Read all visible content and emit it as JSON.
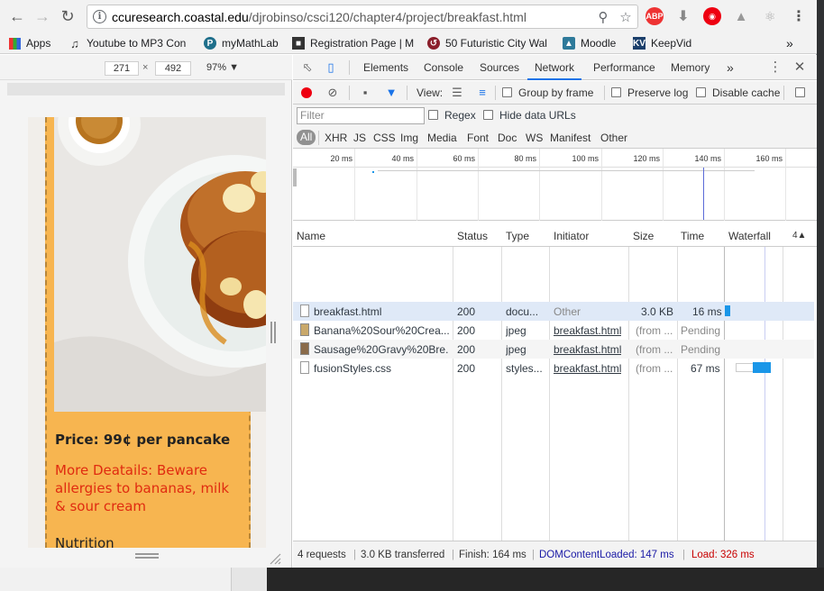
{
  "browser": {
    "url_host": "ccuresearch.coastal.edu",
    "url_path": "/djrobinso/csci120/chapter4/project/breakfast.html",
    "bookmarks": [
      {
        "label": "Apps"
      },
      {
        "label": "Youtube to MP3 Con"
      },
      {
        "label": "myMathLab"
      },
      {
        "label": "Registration Page | M"
      },
      {
        "label": "50 Futuristic City Wal"
      },
      {
        "label": "Moodle"
      },
      {
        "label": "KeepVid"
      }
    ],
    "more_bookmarks": "»"
  },
  "device": {
    "width": "271",
    "height": "492",
    "zoom": "97%"
  },
  "page": {
    "price": "Price: 99¢ per pancake",
    "details": "More Deatails: Beware allergies to bananas, milk & sour cream",
    "nutrition": "Nutrition"
  },
  "devtools": {
    "tabs": [
      "Elements",
      "Console",
      "Sources",
      "Network",
      "Performance",
      "Memory"
    ],
    "more_tabs": "»",
    "toolbar": {
      "view_label": "View:",
      "group_by_frame": "Group by frame",
      "preserve_log": "Preserve log",
      "disable_cache": "Disable cache"
    },
    "filter_placeholder": "Filter",
    "regex": "Regex",
    "hide_data_urls": "Hide data URLs",
    "types": [
      "All",
      "XHR",
      "JS",
      "CSS",
      "Img",
      "Media",
      "Font",
      "Doc",
      "WS",
      "Manifest",
      "Other"
    ],
    "timeline_labels": [
      "20 ms",
      "40 ms",
      "60 ms",
      "80 ms",
      "100 ms",
      "120 ms",
      "140 ms",
      "160 ms"
    ],
    "columns": [
      "Name",
      "Status",
      "Type",
      "Initiator",
      "Size",
      "Time",
      "Waterfall"
    ],
    "sort_indicator": "4▲",
    "requests": [
      {
        "name": "breakfast.html",
        "status": "200",
        "type": "docu...",
        "initiator": "Other",
        "size": "3.0 KB",
        "time": "16 ms"
      },
      {
        "name": "Banana%20Sour%20Crea...",
        "status": "200",
        "type": "jpeg",
        "initiator": "breakfast.html",
        "size": "(from ...",
        "time": "Pending"
      },
      {
        "name": "Sausage%20Gravy%20Bre...",
        "status": "200",
        "type": "jpeg",
        "initiator": "breakfast.html",
        "size": "(from ...",
        "time": "Pending"
      },
      {
        "name": "fusionStyles.css",
        "status": "200",
        "type": "styles...",
        "initiator": "breakfast.html",
        "size": "(from ...",
        "time": "67 ms"
      }
    ],
    "summary": {
      "requests": "4 requests",
      "transferred": "3.0 KB transferred",
      "finish": "Finish: 164 ms",
      "dom_loaded": "DOMContentLoaded: 147 ms",
      "load": "Load: 326 ms"
    },
    "colors": {
      "accent": "#1a73e8",
      "dom_loaded": "#1a1aa6",
      "load": "#c80000",
      "waterfall": "#1a96e8"
    }
  }
}
